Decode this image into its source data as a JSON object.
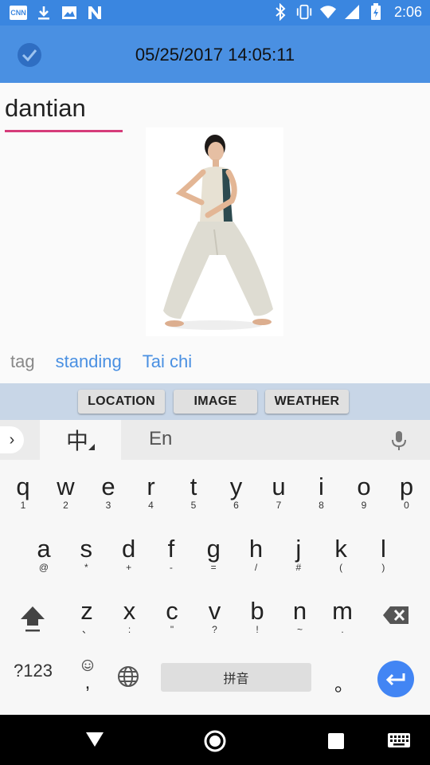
{
  "status_bar": {
    "time": "2:06",
    "left_icons": [
      "cnn-notification-icon",
      "download-icon",
      "image-icon",
      "n-app-icon"
    ],
    "right_icons": [
      "bluetooth-icon",
      "vibrate-icon",
      "wifi-icon",
      "signal-icon",
      "battery-charging-icon"
    ]
  },
  "appbar": {
    "title": "05/25/2017 14:05:11",
    "color": "#4a90e2"
  },
  "title_field": {
    "value": "dantian",
    "underline_color": "#d63c7a"
  },
  "tags": {
    "label": "tag",
    "items": [
      "standing",
      "Tai chi"
    ]
  },
  "actions": {
    "location": "LOCATION",
    "image": "IMAGE",
    "weather": "WEATHER"
  },
  "keyboard": {
    "mode_chinese": "中",
    "mode_english": "En",
    "row1": [
      {
        "k": "q",
        "s": "1"
      },
      {
        "k": "w",
        "s": "2"
      },
      {
        "k": "e",
        "s": "3"
      },
      {
        "k": "r",
        "s": "4"
      },
      {
        "k": "t",
        "s": "5"
      },
      {
        "k": "y",
        "s": "6"
      },
      {
        "k": "u",
        "s": "7"
      },
      {
        "k": "i",
        "s": "8"
      },
      {
        "k": "o",
        "s": "9"
      },
      {
        "k": "p",
        "s": "0"
      }
    ],
    "row2": [
      {
        "k": "a",
        "s": "@"
      },
      {
        "k": "s",
        "s": "*"
      },
      {
        "k": "d",
        "s": "+"
      },
      {
        "k": "f",
        "s": "-"
      },
      {
        "k": "g",
        "s": "="
      },
      {
        "k": "h",
        "s": "/"
      },
      {
        "k": "j",
        "s": "#"
      },
      {
        "k": "k",
        "s": "("
      },
      {
        "k": "l",
        "s": ")"
      }
    ],
    "row3": [
      {
        "k": "z",
        "s": "、"
      },
      {
        "k": "x",
        "s": ":"
      },
      {
        "k": "c",
        "s": "\""
      },
      {
        "k": "v",
        "s": "?"
      },
      {
        "k": "b",
        "s": "!"
      },
      {
        "k": "n",
        "s": "~"
      },
      {
        "k": "m",
        "s": "."
      }
    ],
    "symbols": "?123",
    "comma": ",",
    "space": "拼音",
    "period": "。"
  }
}
